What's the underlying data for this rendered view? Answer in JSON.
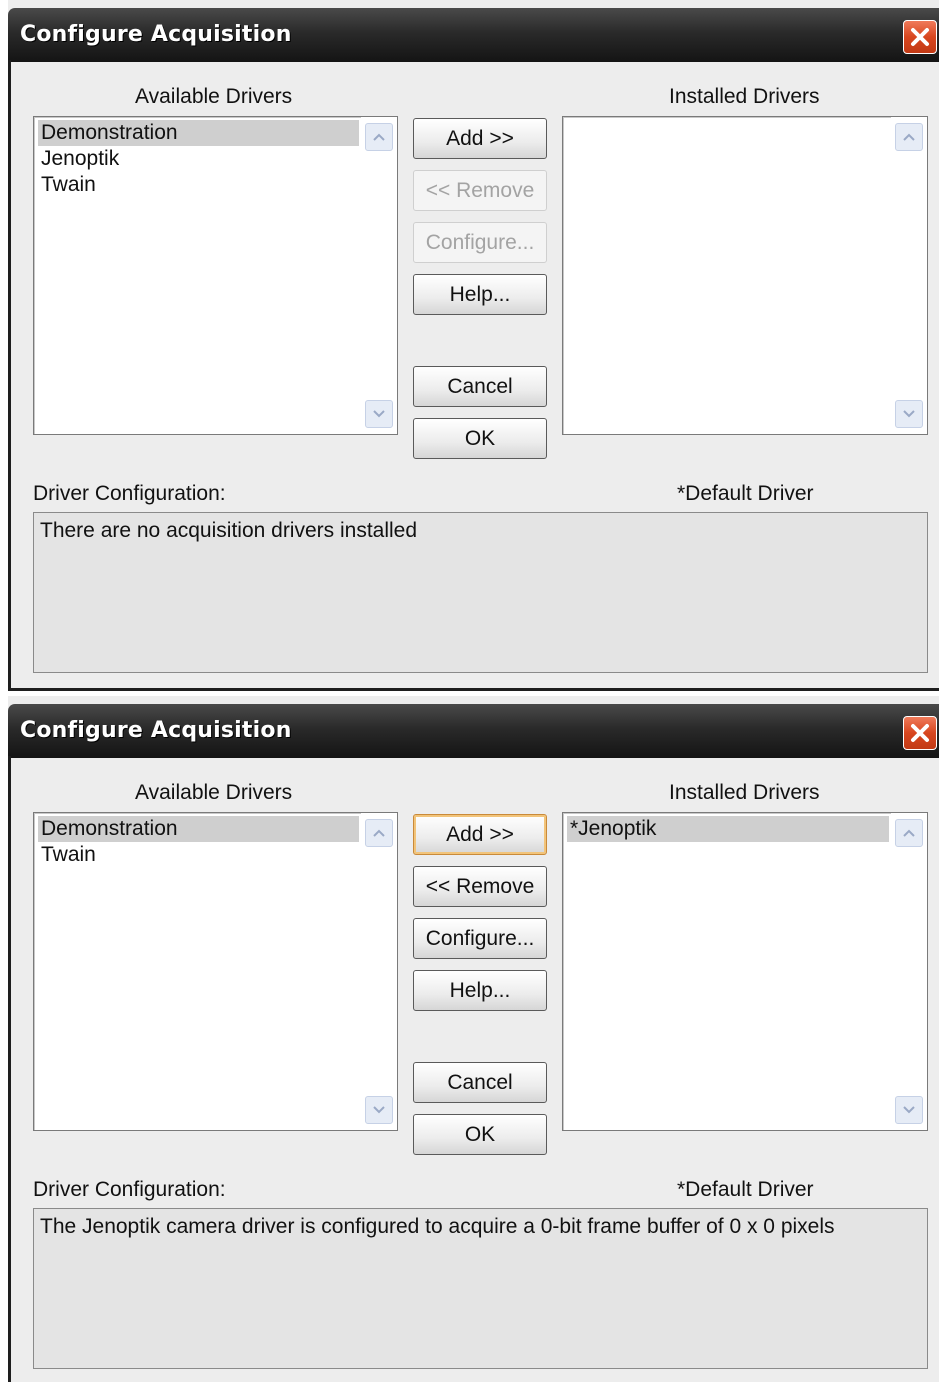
{
  "dialogs": [
    {
      "title": "Configure Acquisition",
      "available_label": "Available Drivers",
      "installed_label": "Installed Drivers",
      "available_items": [
        "Demonstration",
        "Jenoptik",
        "Twain"
      ],
      "installed_items": [],
      "buttons": {
        "add": "Add >>",
        "remove": "<< Remove",
        "configure": "Configure...",
        "help": "Help...",
        "cancel": "Cancel",
        "ok": "OK"
      },
      "config_label": "Driver Configuration:",
      "default_note": "*Default Driver",
      "config_text": "There are no acquisition drivers installed"
    },
    {
      "title": "Configure Acquisition",
      "available_label": "Available Drivers",
      "installed_label": "Installed Drivers",
      "available_items": [
        "Demonstration",
        "Twain"
      ],
      "installed_items": [
        "*Jenoptik"
      ],
      "buttons": {
        "add": "Add >>",
        "remove": "<< Remove",
        "configure": "Configure...",
        "help": "Help...",
        "cancel": "Cancel",
        "ok": "OK"
      },
      "config_label": "Driver Configuration:",
      "default_note": "*Default Driver",
      "config_text": "The Jenoptik camera driver is configured to acquire a 0-bit frame buffer of 0 x 0 pixels"
    }
  ],
  "icons": {
    "close": "close-icon",
    "scroll_up": "chevron-up-icon",
    "scroll_down": "chevron-down-icon"
  }
}
